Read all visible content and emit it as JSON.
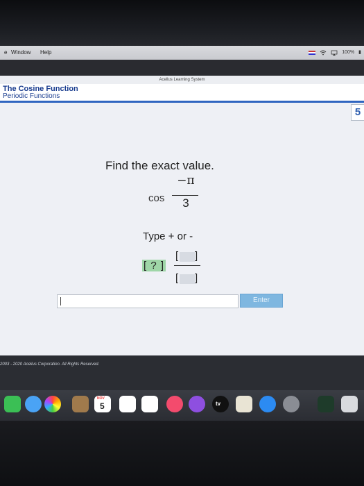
{
  "menubar": {
    "items": [
      "e",
      "Window",
      "Help"
    ],
    "battery": "100%"
  },
  "app": {
    "window_title": "Acellus Learning System",
    "lesson_title": "The Cosine Function",
    "lesson_subtitle": "Periodic Functions",
    "page_number": "5"
  },
  "question": {
    "prompt": "Find the exact value.",
    "func": "cos",
    "numerator": "−π",
    "denominator": "3",
    "hint": "Type + or -",
    "sign_placeholder": "[ ? ]"
  },
  "answer": {
    "input_value": "",
    "enter_label": "Enter"
  },
  "footer": {
    "copyright": "2003 - 2020 Acellus Corporation.  All Rights Reserved."
  },
  "dock": {
    "calendar_month": "NOV",
    "calendar_day": "5",
    "tv_label": "tv"
  },
  "colors": {
    "header_accent": "#2f65c0",
    "enter_button": "#7fb7e0",
    "sign_slot": "#9ed6a7"
  }
}
